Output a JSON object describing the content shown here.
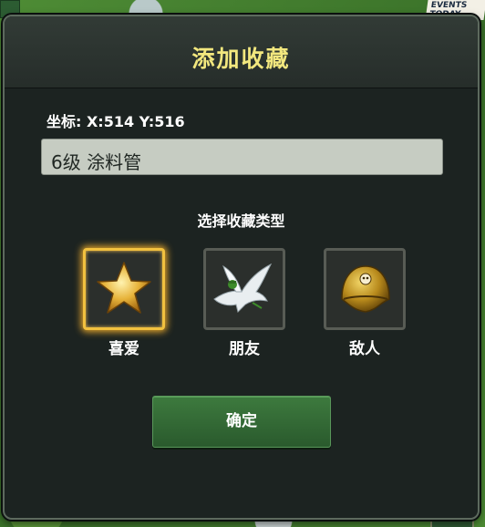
{
  "dialog": {
    "title": "添加收藏",
    "coords_label": "坐标: X:514 Y:516",
    "name_value": "6级 涂料管",
    "type_label": "选择收藏类型",
    "options": [
      {
        "label": "喜爱",
        "icon": "star-icon",
        "selected": true
      },
      {
        "label": "朋友",
        "icon": "dove-icon",
        "selected": false
      },
      {
        "label": "敌人",
        "icon": "helmet-icon",
        "selected": false
      }
    ],
    "confirm_label": "确定"
  },
  "background": {
    "events_badge_line1": "EVENTS",
    "events_badge_line2": "TODAY"
  },
  "colors": {
    "title": "#f2e77e",
    "selected_border": "#f2c13f",
    "confirm_button": "#3d7a3e"
  }
}
